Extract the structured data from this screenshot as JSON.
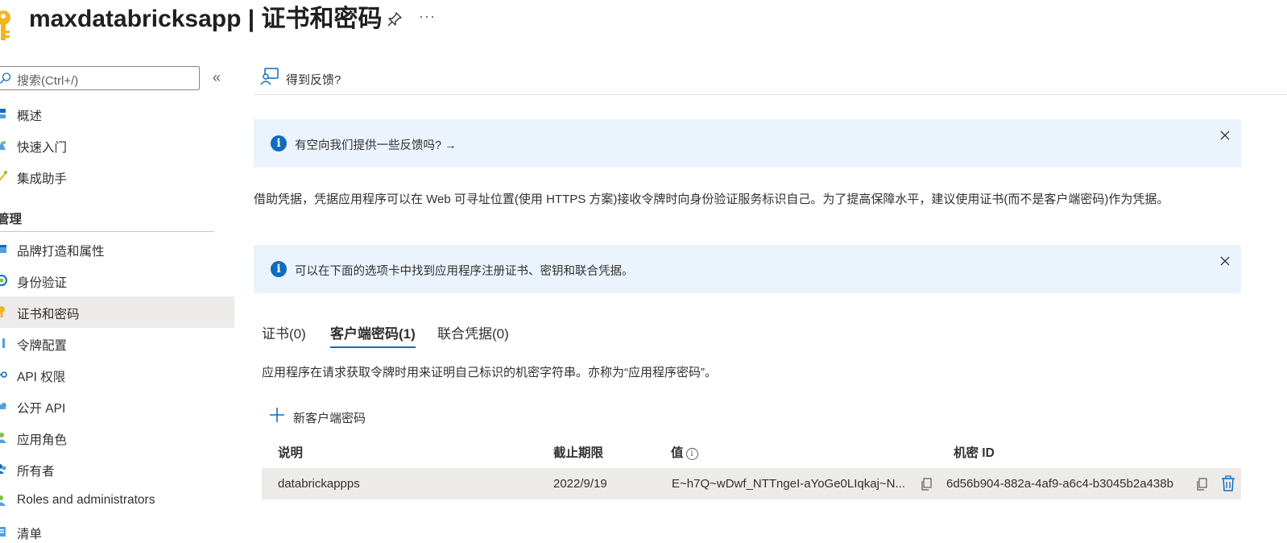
{
  "header": {
    "title": "maxdatabricksapp | 证书和密码",
    "more_label": "···"
  },
  "sidebar": {
    "search_placeholder": "搜索(Ctrl+/)",
    "collapse_label": "«",
    "items_top": [
      {
        "label": "概述",
        "icon": "overview-icon"
      },
      {
        "label": "快速入门",
        "icon": "quickstart-icon"
      },
      {
        "label": "集成助手",
        "icon": "integration-assistant-icon"
      }
    ],
    "section_label": "管理",
    "items_manage": [
      {
        "label": "品牌打造和属性",
        "icon": "branding-icon"
      },
      {
        "label": "身份验证",
        "icon": "authentication-icon"
      },
      {
        "label": "证书和密码",
        "icon": "key-icon",
        "active": true
      },
      {
        "label": "令牌配置",
        "icon": "token-config-icon"
      },
      {
        "label": "API 权限",
        "icon": "api-permissions-icon"
      },
      {
        "label": "公开 API",
        "icon": "expose-api-icon"
      },
      {
        "label": "应用角色",
        "icon": "app-roles-icon"
      },
      {
        "label": "所有者",
        "icon": "owners-icon"
      },
      {
        "label": "Roles and administrators",
        "icon": "roles-admins-icon"
      },
      {
        "label": "清单",
        "icon": "manifest-icon"
      }
    ]
  },
  "main": {
    "feedback_label": "得到反馈?",
    "banner1": "有空向我们提供一些反馈吗? →",
    "description": "借助凭据，凭据应用程序可以在 Web 可寻址位置(使用 HTTPS 方案)接收令牌时向身份验证服务标识自己。为了提高保障水平，建议使用证书(而不是客户端密码)作为凭据。",
    "banner2": "可以在下面的选项卡中找到应用程序注册证书、密钥和联合凭据。",
    "tabs": [
      {
        "label": "证书(0)"
      },
      {
        "label": "客户端密码(1)",
        "active": true
      },
      {
        "label": "联合凭据(0)"
      }
    ],
    "secret_description": "应用程序在请求获取令牌时用来证明自己标识的机密字符串。亦称为“应用程序密码”。",
    "new_secret_label": "新客户端密码",
    "table": {
      "headers": {
        "description": "说明",
        "expires": "截止期限",
        "value": "值",
        "secret_id": "机密 ID"
      },
      "rows": [
        {
          "description": "databrickappps",
          "expires": "2022/9/19",
          "value": "E~h7Q~wDwf_NTTngeI-aYoGe0LIqkaj~N...",
          "secret_id": "6d56b904-882a-4af9-a6c4-b3045b2a438b"
        }
      ]
    }
  },
  "colors": {
    "accent": "#0f6cbd",
    "banner_bg": "#ebf3fc",
    "selected_bg": "#edebe9"
  }
}
